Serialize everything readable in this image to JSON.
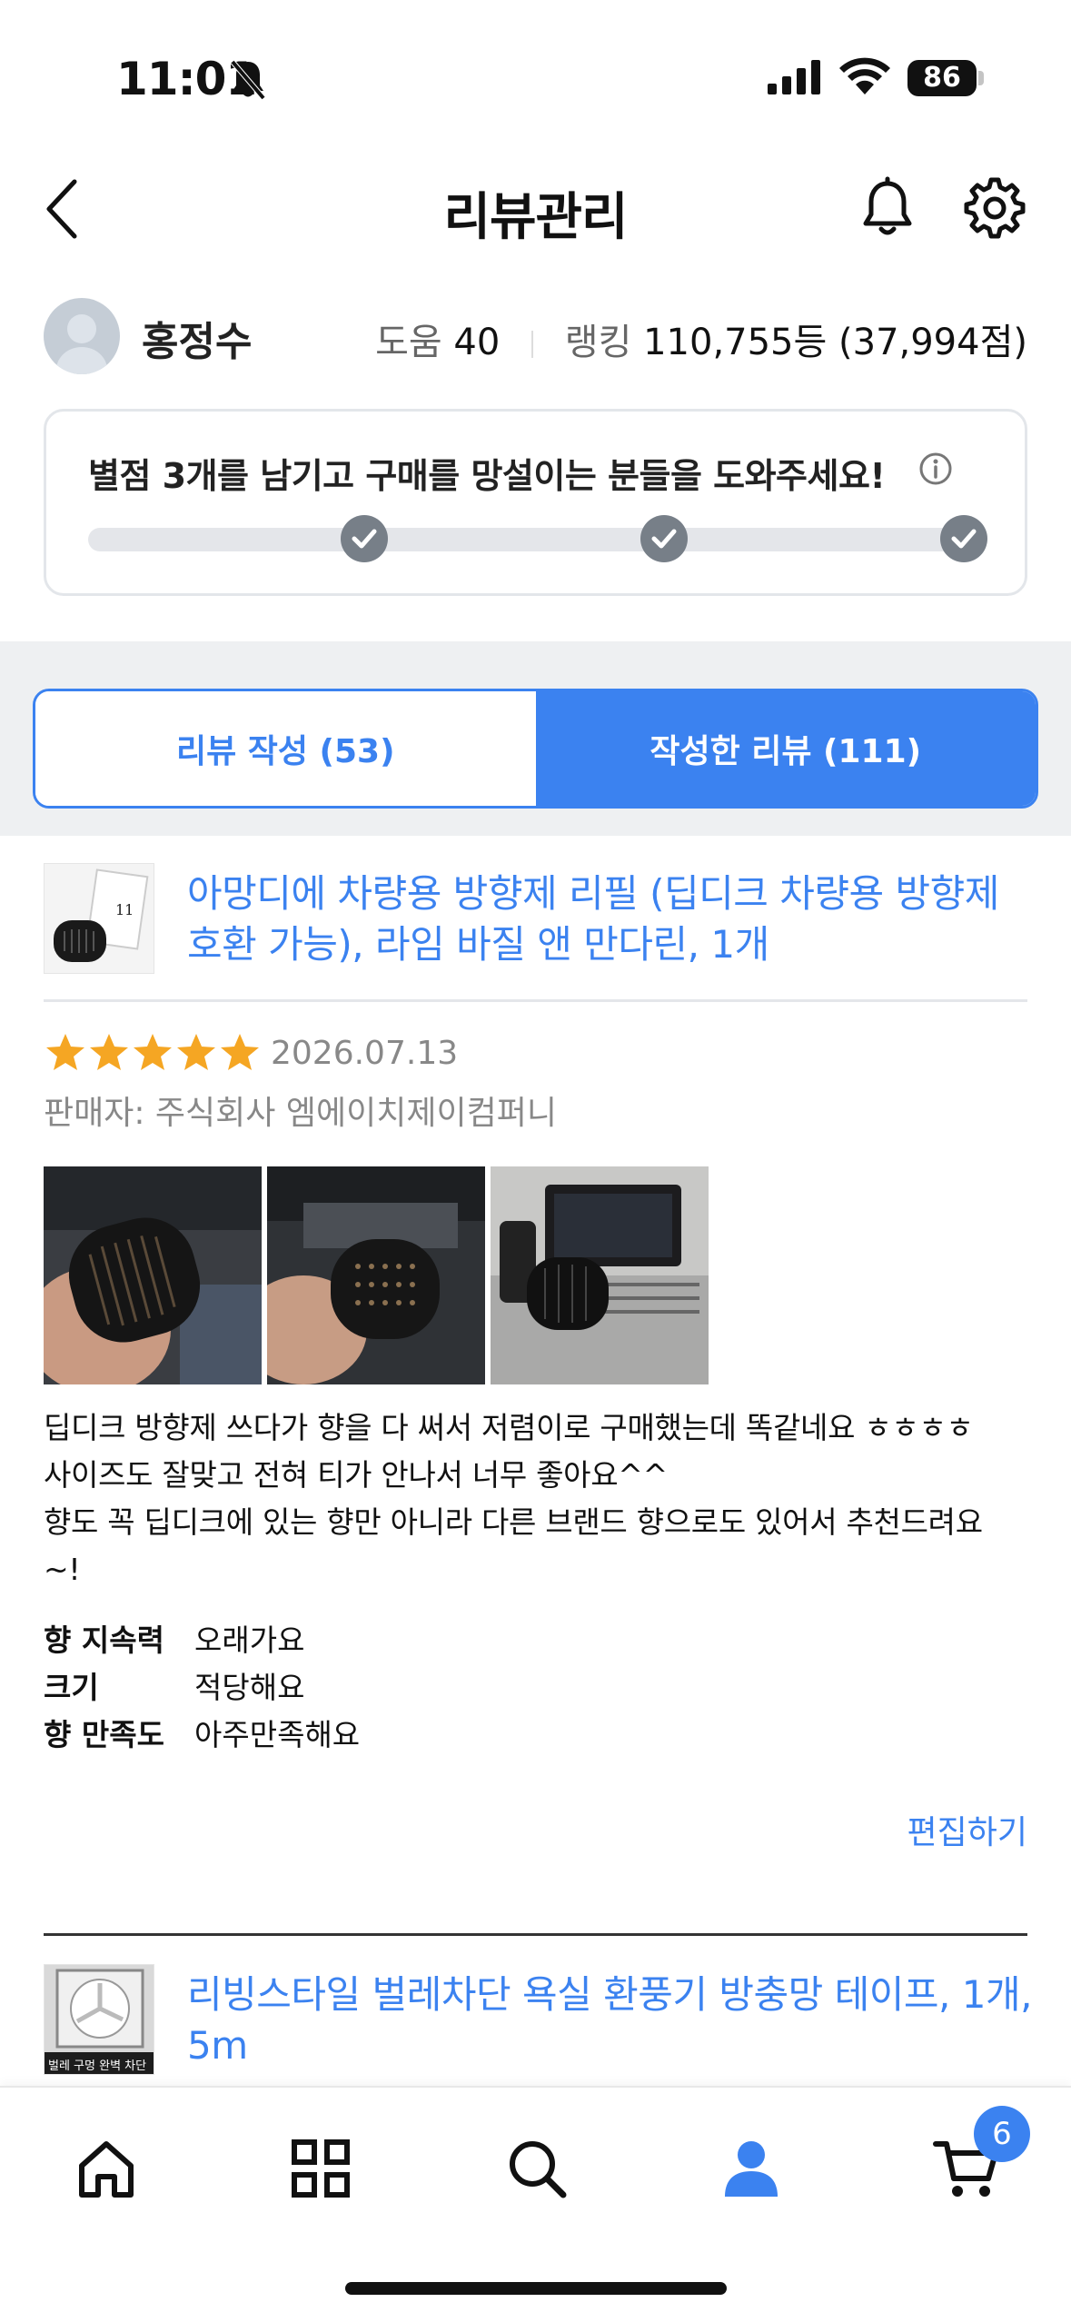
{
  "status_bar": {
    "time": "11:01",
    "battery": "86"
  },
  "nav": {
    "title": "리뷰관리"
  },
  "profile": {
    "name": "홍정수",
    "help_label": "도움",
    "help_value": "40",
    "rank_label": "랭킹",
    "rank_value": "110,755등 (37,994점)"
  },
  "progress": {
    "title": "별점 3개를 남기고 구매를 망설이는 분들을 도와주세요!",
    "steps_completed": 3,
    "steps_total": 3
  },
  "tabs": [
    {
      "label": "리뷰 작성 (53)",
      "active": false
    },
    {
      "label": "작성한 리뷰 (111)",
      "active": true
    }
  ],
  "review": {
    "product_title": "아망디에 차량용 방향제 리필 (딥디크 차량용 방향제 호환 가능), 라임 바질 앤 만다린, 1개",
    "rating": 5,
    "date": "2026.07.13",
    "seller": "판매자: 주식회사 엠에이치제이컴퍼니",
    "text_lines": [
      "딥디크 방향제 쓰다가 향을 다 써서 저렴이로 구매했는데 똑같네요 ㅎㅎㅎㅎ",
      "사이즈도 잘맞고 전혀 티가 안나서 너무 좋아요^^",
      "향도 꼭 딥디크에 있는 향만 아니라 다른 브랜드 향으로도 있어서 추천드려요",
      "~!"
    ],
    "attributes": [
      {
        "label": "향 지속력",
        "value": "오래가요"
      },
      {
        "label": "크기",
        "value": "적당해요"
      },
      {
        "label": "향 만족도",
        "value": "아주만족해요"
      }
    ],
    "edit_label": "편집하기"
  },
  "next_review": {
    "product_title": "리빙스타일 벌레차단 욕실 환풍기 방충망 테이프, 1개, 5m",
    "thumb_caption": "벌레 구멍 완벽 차단"
  },
  "bottom_nav": {
    "items": [
      "home-icon",
      "category-icon",
      "search-icon",
      "profile-icon",
      "cart-icon"
    ],
    "cart_badge": "6",
    "active_color": "#3b82f0"
  },
  "colors": {
    "accent": "#3b82f0",
    "star": "#f5a623"
  }
}
